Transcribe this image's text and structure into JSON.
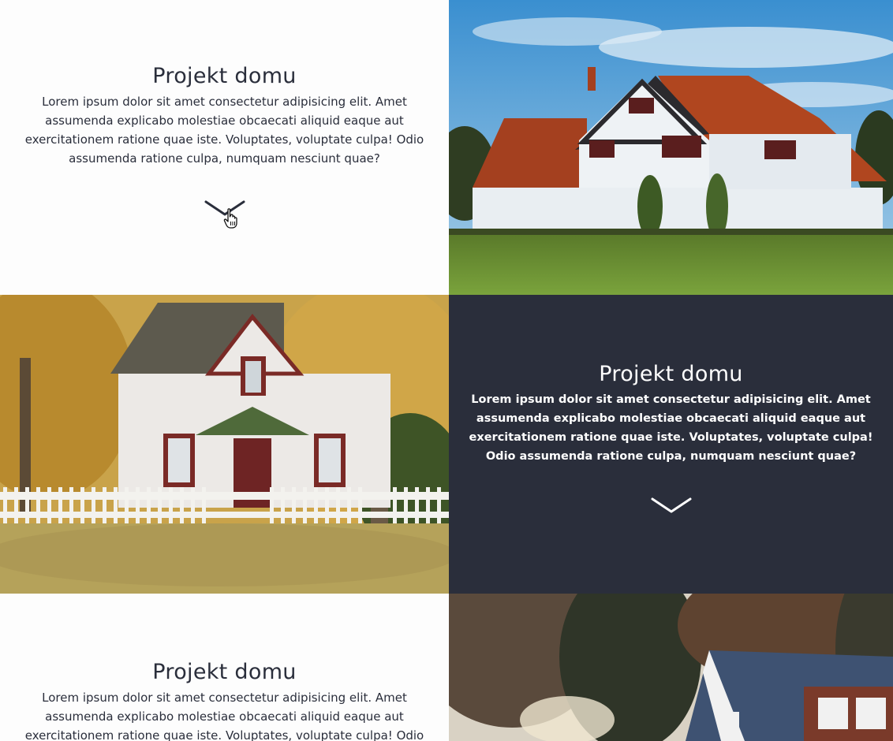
{
  "sections": [
    {
      "title": "Projekt domu",
      "description": "Lorem ipsum dolor sit amet consectetur adipisicing elit. Amet assumenda explicabo molestiae obcaecati aliquid eaque aut exercitationem ratione quae iste. Voluptates, voluptate culpa! Odio assumenda ratione culpa, numquam nesciunt quae?",
      "expand_icon": "chevron-down-icon",
      "photo": "tudor-house-photo"
    },
    {
      "title": "Projekt domu",
      "description": "Lorem ipsum dolor sit amet consectetur adipisicing elit. Amet assumenda explicabo molestiae obcaecati aliquid eaque aut exercitationem ratione quae iste. Voluptates, voluptate culpa! Odio assumenda ratione culpa, numquam nesciunt quae?",
      "expand_icon": "chevron-down-icon",
      "photo": "white-farmhouse-photo"
    },
    {
      "title": "Projekt domu",
      "description": "Lorem ipsum dolor sit amet consectetur adipisicing elit. Amet assumenda explicabo molestiae obcaecati aliquid eaque aut exercitationem ratione quae iste. Voluptates, voluptate culpa! Odio assumenda ratione culpa, numquam nesciunt quae?",
      "photo": "forest-cabin-photo"
    }
  ],
  "colors": {
    "light_bg": "#fdfdfd",
    "dark_bg": "#2a2e3b",
    "text_dark": "#2a2e3b",
    "text_light": "#ffffff"
  }
}
